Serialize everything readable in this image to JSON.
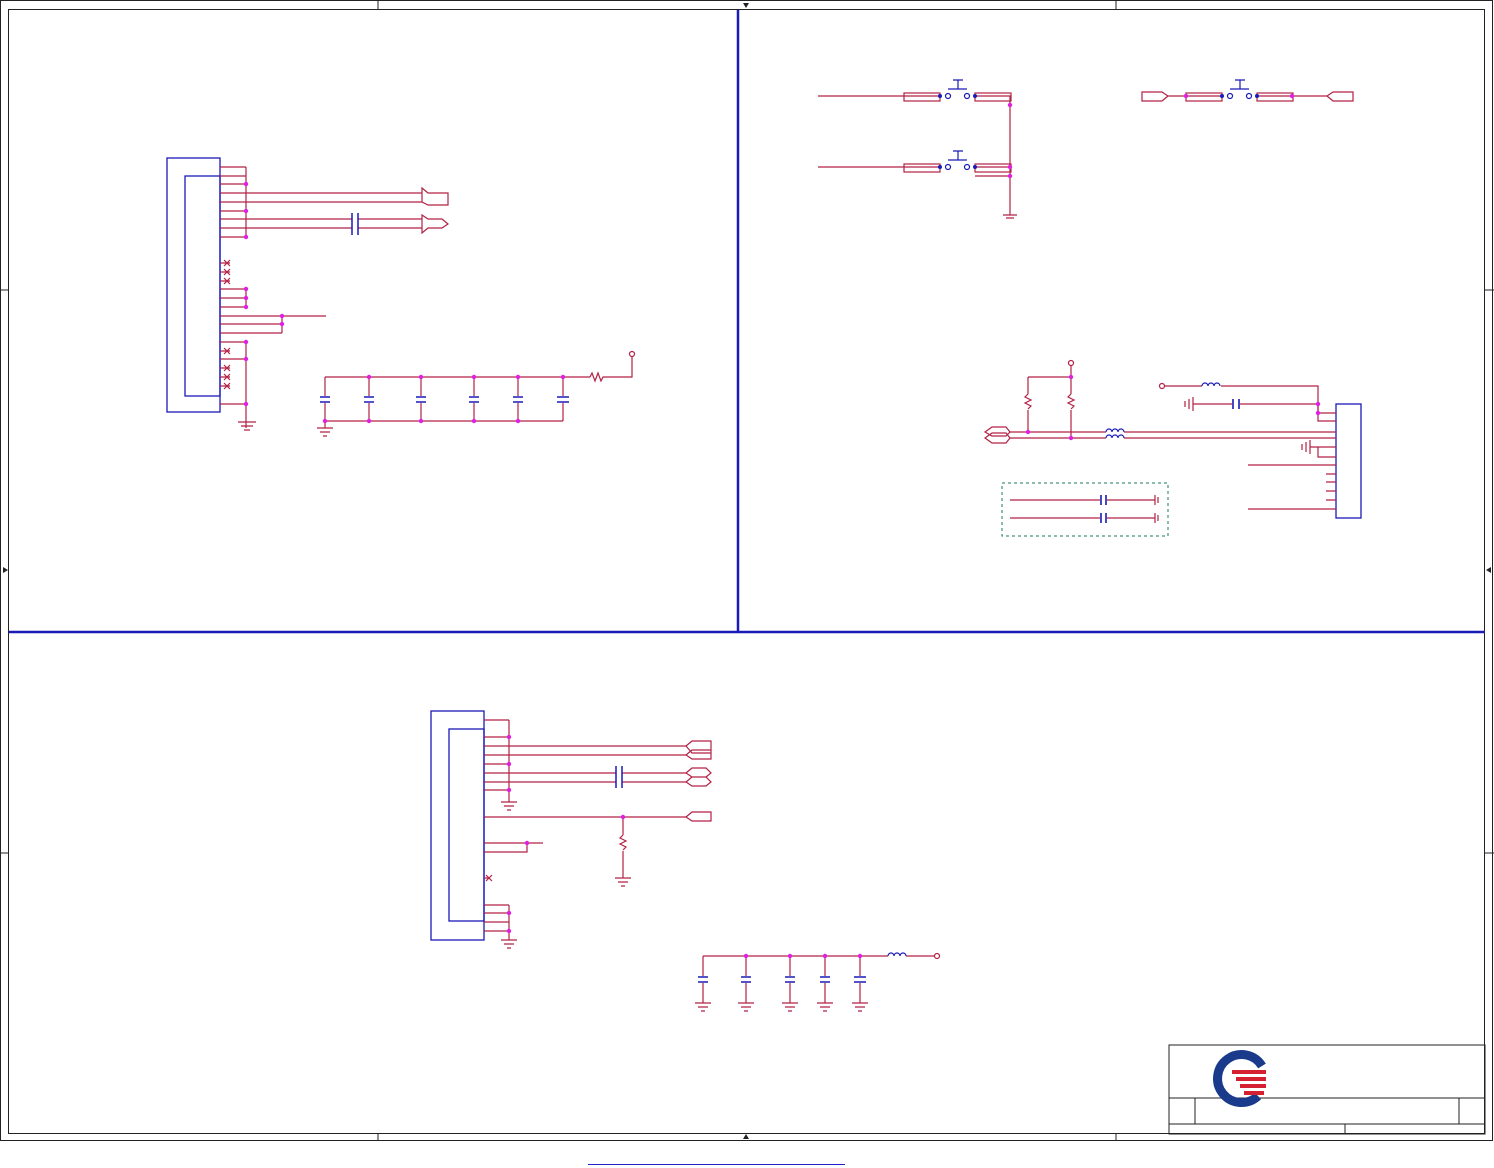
{
  "sheet": {
    "background": "#ffffff",
    "frame_color": "#1a1ab8",
    "wire_color": "#b22244",
    "component_color": "#1a1ab8",
    "junction_color": "#e020e0",
    "group_box_color": "#1a7a5a"
  },
  "title_block": {
    "logo": "quanta-logo-icon",
    "logo_colors": [
      "#1a3a8c",
      "#d42030"
    ]
  },
  "footer": {
    "link_color": "#2222cc"
  }
}
